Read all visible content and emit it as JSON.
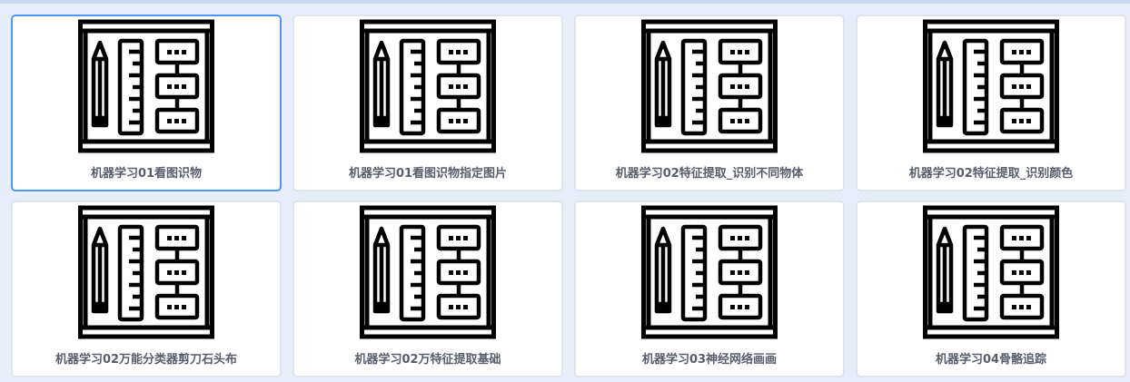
{
  "projects": [
    {
      "title": "机器学习01看图识物",
      "icon": "blueprint-icon",
      "selected": true
    },
    {
      "title": "机器学习01看图识物指定图片",
      "icon": "blueprint-icon",
      "selected": false
    },
    {
      "title": "机器学习02特征提取_识别不同物体",
      "icon": "blueprint-icon",
      "selected": false
    },
    {
      "title": "机器学习02特征提取_识别颜色",
      "icon": "blueprint-icon",
      "selected": false
    },
    {
      "title": "机器学习02万能分类器剪刀石头布",
      "icon": "blueprint-icon",
      "selected": false
    },
    {
      "title": "机器学习02万特征提取基础",
      "icon": "blueprint-icon",
      "selected": false
    },
    {
      "title": "机器学习03神经网络画画",
      "icon": "blueprint-icon",
      "selected": false
    },
    {
      "title": "机器学习04骨骼追踪",
      "icon": "blueprint-icon",
      "selected": false
    }
  ],
  "colors": {
    "selected_border": "#4d97f3",
    "card_border": "#dfe4ec",
    "title": "#585e6b",
    "background": "#e8eef9"
  }
}
